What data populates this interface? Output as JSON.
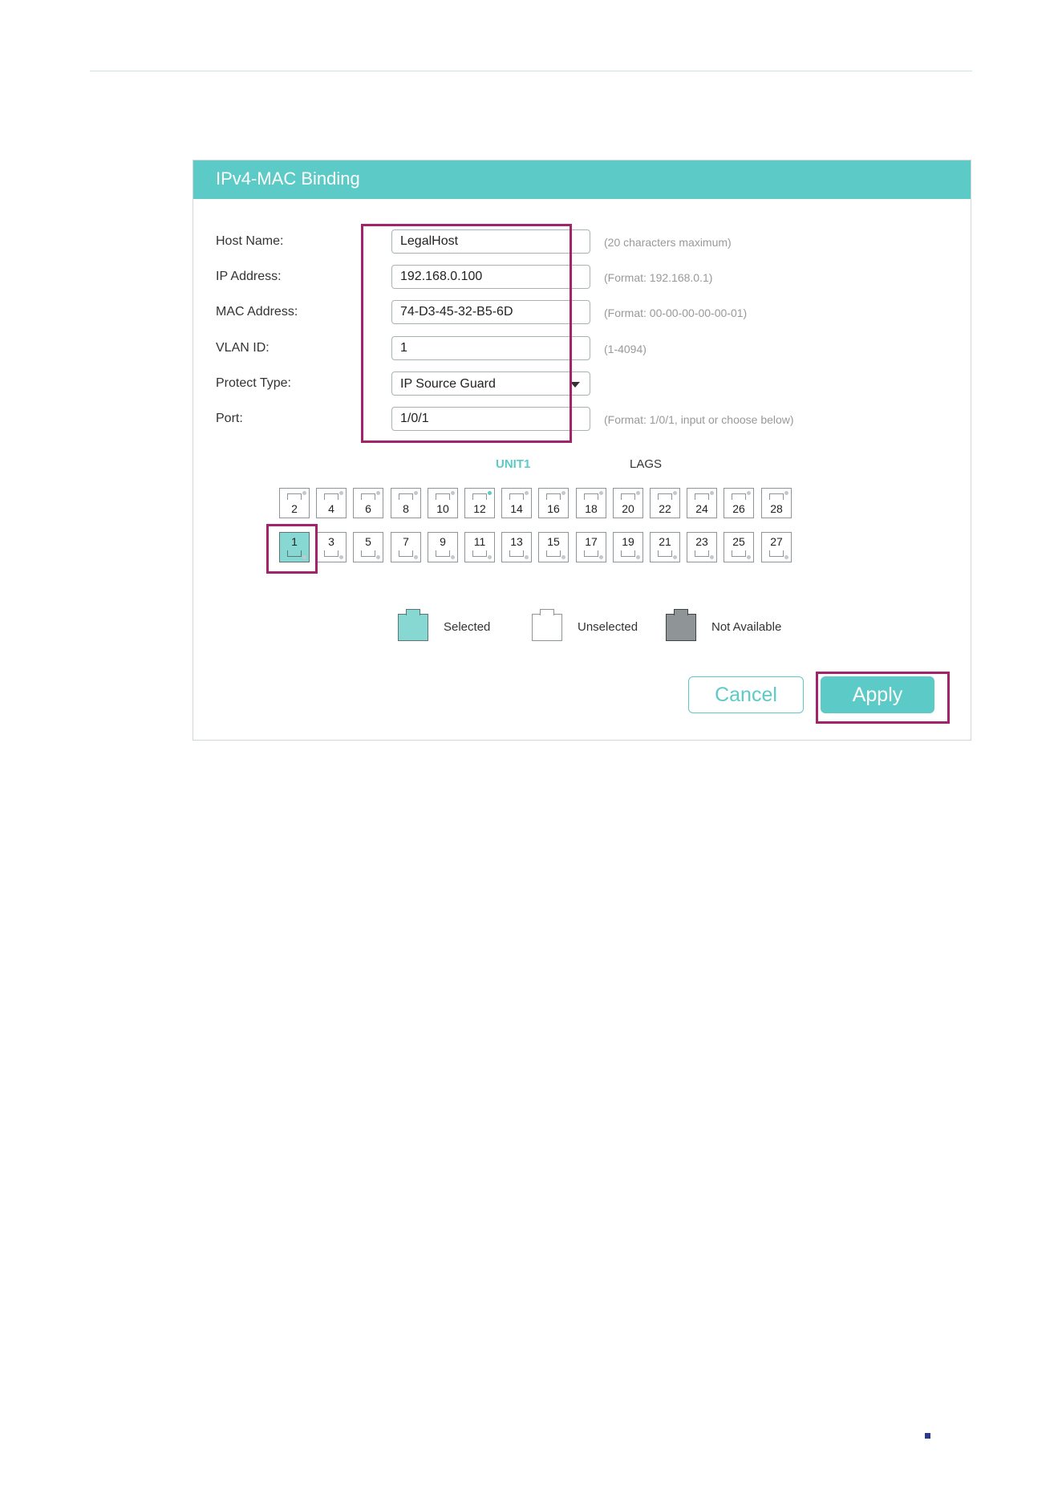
{
  "panel": {
    "title": "IPv4-MAC Binding"
  },
  "form": {
    "host_name": {
      "label": "Host Name:",
      "value": "LegalHost",
      "hint": "(20 characters maximum)"
    },
    "ip_address": {
      "label": "IP Address:",
      "value": "192.168.0.100",
      "hint": "(Format: 192.168.0.1)"
    },
    "mac_address": {
      "label": "MAC Address:",
      "value": "74-D3-45-32-B5-6D",
      "hint": "(Format: 00-00-00-00-00-01)"
    },
    "vlan_id": {
      "label": "VLAN ID:",
      "value": "1",
      "hint": "(1-4094)"
    },
    "protect_type": {
      "label": "Protect Type:",
      "value": "IP Source Guard"
    },
    "port": {
      "label": "Port:",
      "value": "1/0/1",
      "hint": "(Format: 1/0/1, input or choose below)"
    }
  },
  "port_panel": {
    "unit_tab": "UNIT1",
    "lags_tab": "LAGS",
    "top_row": [
      "2",
      "4",
      "6",
      "8",
      "10",
      "12",
      "14",
      "16",
      "18",
      "20",
      "22",
      "24",
      "26",
      "28"
    ],
    "bottom_row": [
      "1",
      "3",
      "5",
      "7",
      "9",
      "11",
      "13",
      "15",
      "17",
      "19",
      "21",
      "23",
      "25",
      "27"
    ],
    "selected": [
      "1"
    ],
    "link_up": [
      "12"
    ]
  },
  "legend": {
    "selected": "Selected",
    "unselected": "Unselected",
    "not_available": "Not Available"
  },
  "buttons": {
    "cancel": "Cancel",
    "apply": "Apply"
  },
  "colors": {
    "accent": "#5ccac6",
    "highlight": "#a3236b",
    "not_available": "#8f9497",
    "selected_fill": "#87d8d2"
  }
}
